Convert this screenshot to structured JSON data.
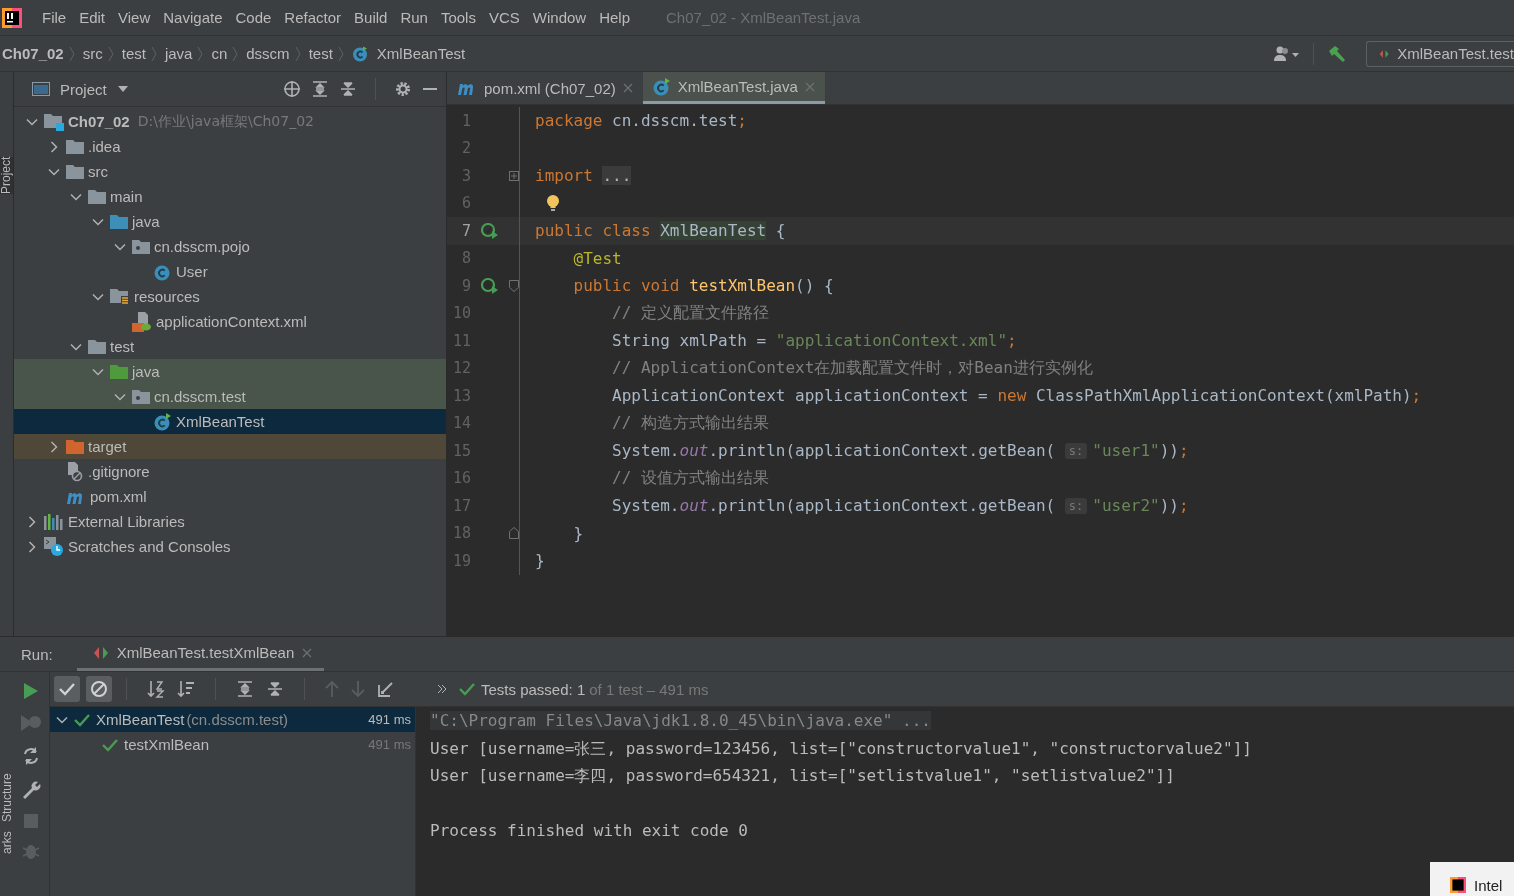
{
  "menu": [
    "File",
    "Edit",
    "View",
    "Navigate",
    "Code",
    "Refactor",
    "Build",
    "Run",
    "Tools",
    "VCS",
    "Window",
    "Help"
  ],
  "window": {
    "title": "Ch07_02 - XmlBeanTest.java"
  },
  "breadcrumbs": [
    {
      "label": "Ch07_02",
      "kind": "project"
    },
    {
      "label": "src",
      "kind": "dir"
    },
    {
      "label": "test",
      "kind": "dir"
    },
    {
      "label": "java",
      "kind": "dir"
    },
    {
      "label": "cn",
      "kind": "dir"
    },
    {
      "label": "dsscm",
      "kind": "dir"
    },
    {
      "label": "test",
      "kind": "dir"
    },
    {
      "label": "XmlBeanTest",
      "kind": "class"
    }
  ],
  "run_config": {
    "label": "XmlBeanTest.test"
  },
  "side_tabs": {
    "top": "Project",
    "bottom": [
      "Structure",
      "arks"
    ]
  },
  "project": {
    "title": "Project",
    "tree": [
      {
        "label": "Ch07_02",
        "path": "D:\\作业\\java框架\\Ch07_02",
        "kind": "module",
        "expanded": true,
        "selected": false,
        "children": [
          {
            "label": ".idea",
            "kind": "folder",
            "expanded": false,
            "selected": false
          },
          {
            "label": "src",
            "kind": "folder",
            "expanded": true,
            "selected": false,
            "children": [
              {
                "label": "main",
                "kind": "folder",
                "expanded": true,
                "selected": false,
                "children": [
                  {
                    "label": "java",
                    "kind": "source",
                    "expanded": true,
                    "selected": false,
                    "children": [
                      {
                        "label": "cn.dsscm.pojo",
                        "kind": "package",
                        "expanded": true,
                        "selected": false,
                        "children": [
                          {
                            "label": "User",
                            "kind": "class",
                            "selected": false
                          }
                        ]
                      }
                    ]
                  },
                  {
                    "label": "resources",
                    "kind": "resources",
                    "expanded": true,
                    "selected": false,
                    "children": [
                      {
                        "label": "applicationContext.xml",
                        "kind": "xml",
                        "selected": false
                      }
                    ]
                  }
                ]
              },
              {
                "label": "test",
                "kind": "folder",
                "expanded": true,
                "selected": false,
                "children": [
                  {
                    "label": "java",
                    "kind": "test-source",
                    "expanded": true,
                    "selected": false,
                    "children": [
                      {
                        "label": "cn.dsscm.test",
                        "kind": "test-package",
                        "expanded": true,
                        "selected": false,
                        "children": [
                          {
                            "label": "XmlBeanTest",
                            "kind": "test-class",
                            "selected": true
                          }
                        ]
                      }
                    ]
                  }
                ]
              }
            ]
          },
          {
            "label": "target",
            "kind": "excluded",
            "expanded": false,
            "selected": false
          },
          {
            "label": ".gitignore",
            "kind": "ignore",
            "selected": false
          },
          {
            "label": "pom.xml",
            "kind": "maven",
            "selected": false
          }
        ]
      },
      {
        "label": "External Libraries",
        "kind": "libraries",
        "expanded": false,
        "selected": false
      },
      {
        "label": "Scratches and Consoles",
        "kind": "scratches",
        "expanded": false,
        "selected": false
      }
    ]
  },
  "editor": {
    "tabs": [
      {
        "label": "pom.xml (Ch07_02)",
        "kind": "maven",
        "selected": false
      },
      {
        "label": "XmlBeanTest.java",
        "kind": "class",
        "selected": true
      }
    ],
    "lines": [
      {
        "n": "1",
        "kind": "plain",
        "run": false,
        "bulb": false,
        "current": false,
        "tokens": [
          {
            "kind": "kw",
            "text": "package "
          },
          {
            "kind": "plain",
            "text": "cn.dsscm.test"
          },
          {
            "kind": "kw",
            "text": ";"
          }
        ]
      },
      {
        "n": "2",
        "kind": "plain",
        "run": false,
        "bulb": false,
        "current": false
      },
      {
        "n": "3",
        "kind": "fold-collapsed",
        "run": false,
        "bulb": false,
        "current": false,
        "tokens": [
          {
            "kind": "kw",
            "text": "import "
          },
          {
            "kind": "folded",
            "text": "..."
          }
        ]
      },
      {
        "n": "6",
        "kind": "plain",
        "run": false,
        "bulb": true,
        "current": false
      },
      {
        "n": "7",
        "kind": "plain",
        "run": true,
        "bulb": false,
        "current": true,
        "tokens": [
          {
            "kind": "kw",
            "text": "public class "
          },
          {
            "kind": "mark",
            "text": "XmlBeanTest"
          },
          {
            "kind": "plain",
            "text": " {"
          }
        ]
      },
      {
        "n": "8",
        "kind": "plain",
        "run": false,
        "bulb": false,
        "current": false,
        "tokens": [
          {
            "kind": "ann",
            "text": "    @Test"
          }
        ]
      },
      {
        "n": "9",
        "kind": "fold-start",
        "run": true,
        "bulb": false,
        "current": false,
        "tokens": [
          {
            "kind": "kw",
            "text": "    public void "
          },
          {
            "kind": "fn",
            "text": "testXmlBean"
          },
          {
            "kind": "plain",
            "text": "() {"
          }
        ]
      },
      {
        "n": "10",
        "kind": "plain",
        "run": false,
        "bulb": false,
        "current": false,
        "tokens": [
          {
            "kind": "comment",
            "text": "        // 定义配置文件路径"
          }
        ]
      },
      {
        "n": "11",
        "kind": "plain",
        "run": false,
        "bulb": false,
        "current": false,
        "tokens": [
          {
            "kind": "plain",
            "text": "        String xmlPath = "
          },
          {
            "kind": "str",
            "text": "\"applicationContext.xml\""
          },
          {
            "kind": "kw",
            "text": ";"
          }
        ]
      },
      {
        "n": "12",
        "kind": "plain",
        "run": false,
        "bulb": false,
        "current": false,
        "tokens": [
          {
            "kind": "comment",
            "text": "        // ApplicationContext在加载配置文件时，对Bean进行实例化"
          }
        ]
      },
      {
        "n": "13",
        "kind": "plain",
        "run": false,
        "bulb": false,
        "current": false,
        "tokens": [
          {
            "kind": "plain",
            "text": "        ApplicationContext applicationContext = "
          },
          {
            "kind": "kw",
            "text": "new "
          },
          {
            "kind": "plain",
            "text": "ClassPathXmlApplicationContext(xmlPath)"
          },
          {
            "kind": "kw",
            "text": ";"
          }
        ]
      },
      {
        "n": "14",
        "kind": "plain",
        "run": false,
        "bulb": false,
        "current": false,
        "tokens": [
          {
            "kind": "comment",
            "text": "        // 构造方式输出结果"
          }
        ]
      },
      {
        "n": "15",
        "kind": "plain",
        "run": false,
        "bulb": false,
        "current": false,
        "tokens": [
          {
            "kind": "plain",
            "text": "        System."
          },
          {
            "kind": "static",
            "text": "out"
          },
          {
            "kind": "plain",
            "text": ".println(applicationContext.getBean( "
          },
          {
            "kind": "hint",
            "text": "s:"
          },
          {
            "kind": "str",
            "text": "\"user1\""
          },
          {
            "kind": "plain",
            "text": "))"
          },
          {
            "kind": "kw",
            "text": ";"
          }
        ]
      },
      {
        "n": "16",
        "kind": "plain",
        "run": false,
        "bulb": false,
        "current": false,
        "tokens": [
          {
            "kind": "comment",
            "text": "        // 设值方式输出结果"
          }
        ]
      },
      {
        "n": "17",
        "kind": "plain",
        "run": false,
        "bulb": false,
        "current": false,
        "tokens": [
          {
            "kind": "plain",
            "text": "        System."
          },
          {
            "kind": "static",
            "text": "out"
          },
          {
            "kind": "plain",
            "text": ".println(applicationContext.getBean( "
          },
          {
            "kind": "hint",
            "text": "s:"
          },
          {
            "kind": "str",
            "text": "\"user2\""
          },
          {
            "kind": "plain",
            "text": "))"
          },
          {
            "kind": "kw",
            "text": ";"
          }
        ]
      },
      {
        "n": "18",
        "kind": "fold-end",
        "run": false,
        "bulb": false,
        "current": false,
        "tokens": [
          {
            "kind": "plain",
            "text": "    }"
          }
        ]
      },
      {
        "n": "19",
        "kind": "plain",
        "run": false,
        "bulb": false,
        "current": false,
        "tokens": [
          {
            "kind": "plain",
            "text": "}"
          }
        ]
      }
    ]
  },
  "run": {
    "label": "Run:",
    "tab": "XmlBeanTest.testXmlBean",
    "status": {
      "passed": "Tests passed: 1",
      "detail": "of 1 test – 491 ms"
    },
    "toolbar": [
      {
        "kind": "passed",
        "on": true
      },
      {
        "kind": "ignored",
        "on": true
      }
    ],
    "tests": [
      {
        "label": "XmlBeanTest",
        "package": "(cn.dsscm.test)",
        "time": "491 ms",
        "selected": true,
        "expanded": true,
        "children": [
          {
            "label": "testXmlBean",
            "time": "491 ms",
            "selected": false
          }
        ]
      }
    ],
    "console": [
      {
        "kind": "command",
        "text": "\"C:\\Program Files\\Java\\jdk1.8.0_45\\bin\\java.exe\" ..."
      },
      {
        "kind": "output",
        "text": "User [username=张三, password=123456, list=[\"constructorvalue1\", \"constructorvalue2\"]]"
      },
      {
        "kind": "output",
        "text": "User [username=李四, password=654321, list=[\"setlistvalue1\", \"setlistvalue2\"]]"
      },
      {
        "kind": "exit",
        "text": "Process finished with exit code 0"
      }
    ]
  },
  "notification": {
    "text": "Intel"
  }
}
